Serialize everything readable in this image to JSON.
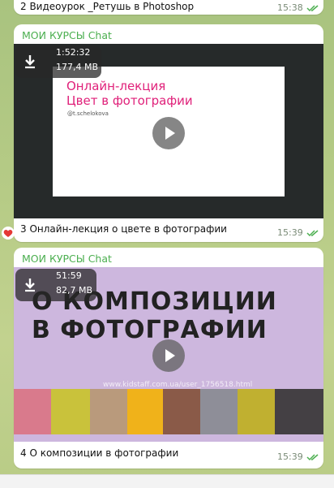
{
  "top_message": {
    "caption": "2 Видеоурок _Ретушь в Photoshop",
    "time": "15:38"
  },
  "messages": [
    {
      "sender": "МОИ КУРСЫ Chat",
      "duration": "1:52:32",
      "size": "177,4 MB",
      "slide_title_line1": "Онлайн-лекция",
      "slide_title_line2": "Цвет в фотографии",
      "slide_handle": "@t.schelokova",
      "caption": "3 Онлайн-лекция о цвете в фотографии",
      "time": "15:39"
    },
    {
      "sender": "МОИ КУРСЫ Chat",
      "duration": "51:59",
      "size": "82,7 MB",
      "slide_title_line1": "О КОМПОЗИЦИИ",
      "slide_title_line2": "В ФОТОГРАФИИ",
      "watermark": "www.kidstaff.com.ua/user_1756518.html",
      "caption": "4 О композиции в фотографии",
      "time": "15:39"
    }
  ],
  "colors": {
    "sender": "#4caf50",
    "accent_pink": "#e0217a",
    "lilac": "#cdb7de",
    "ticks": "#4caf50",
    "heart": "#e53935"
  },
  "icons": [
    "download-icon",
    "play-icon",
    "double-check-icon",
    "heart-reaction-icon"
  ]
}
